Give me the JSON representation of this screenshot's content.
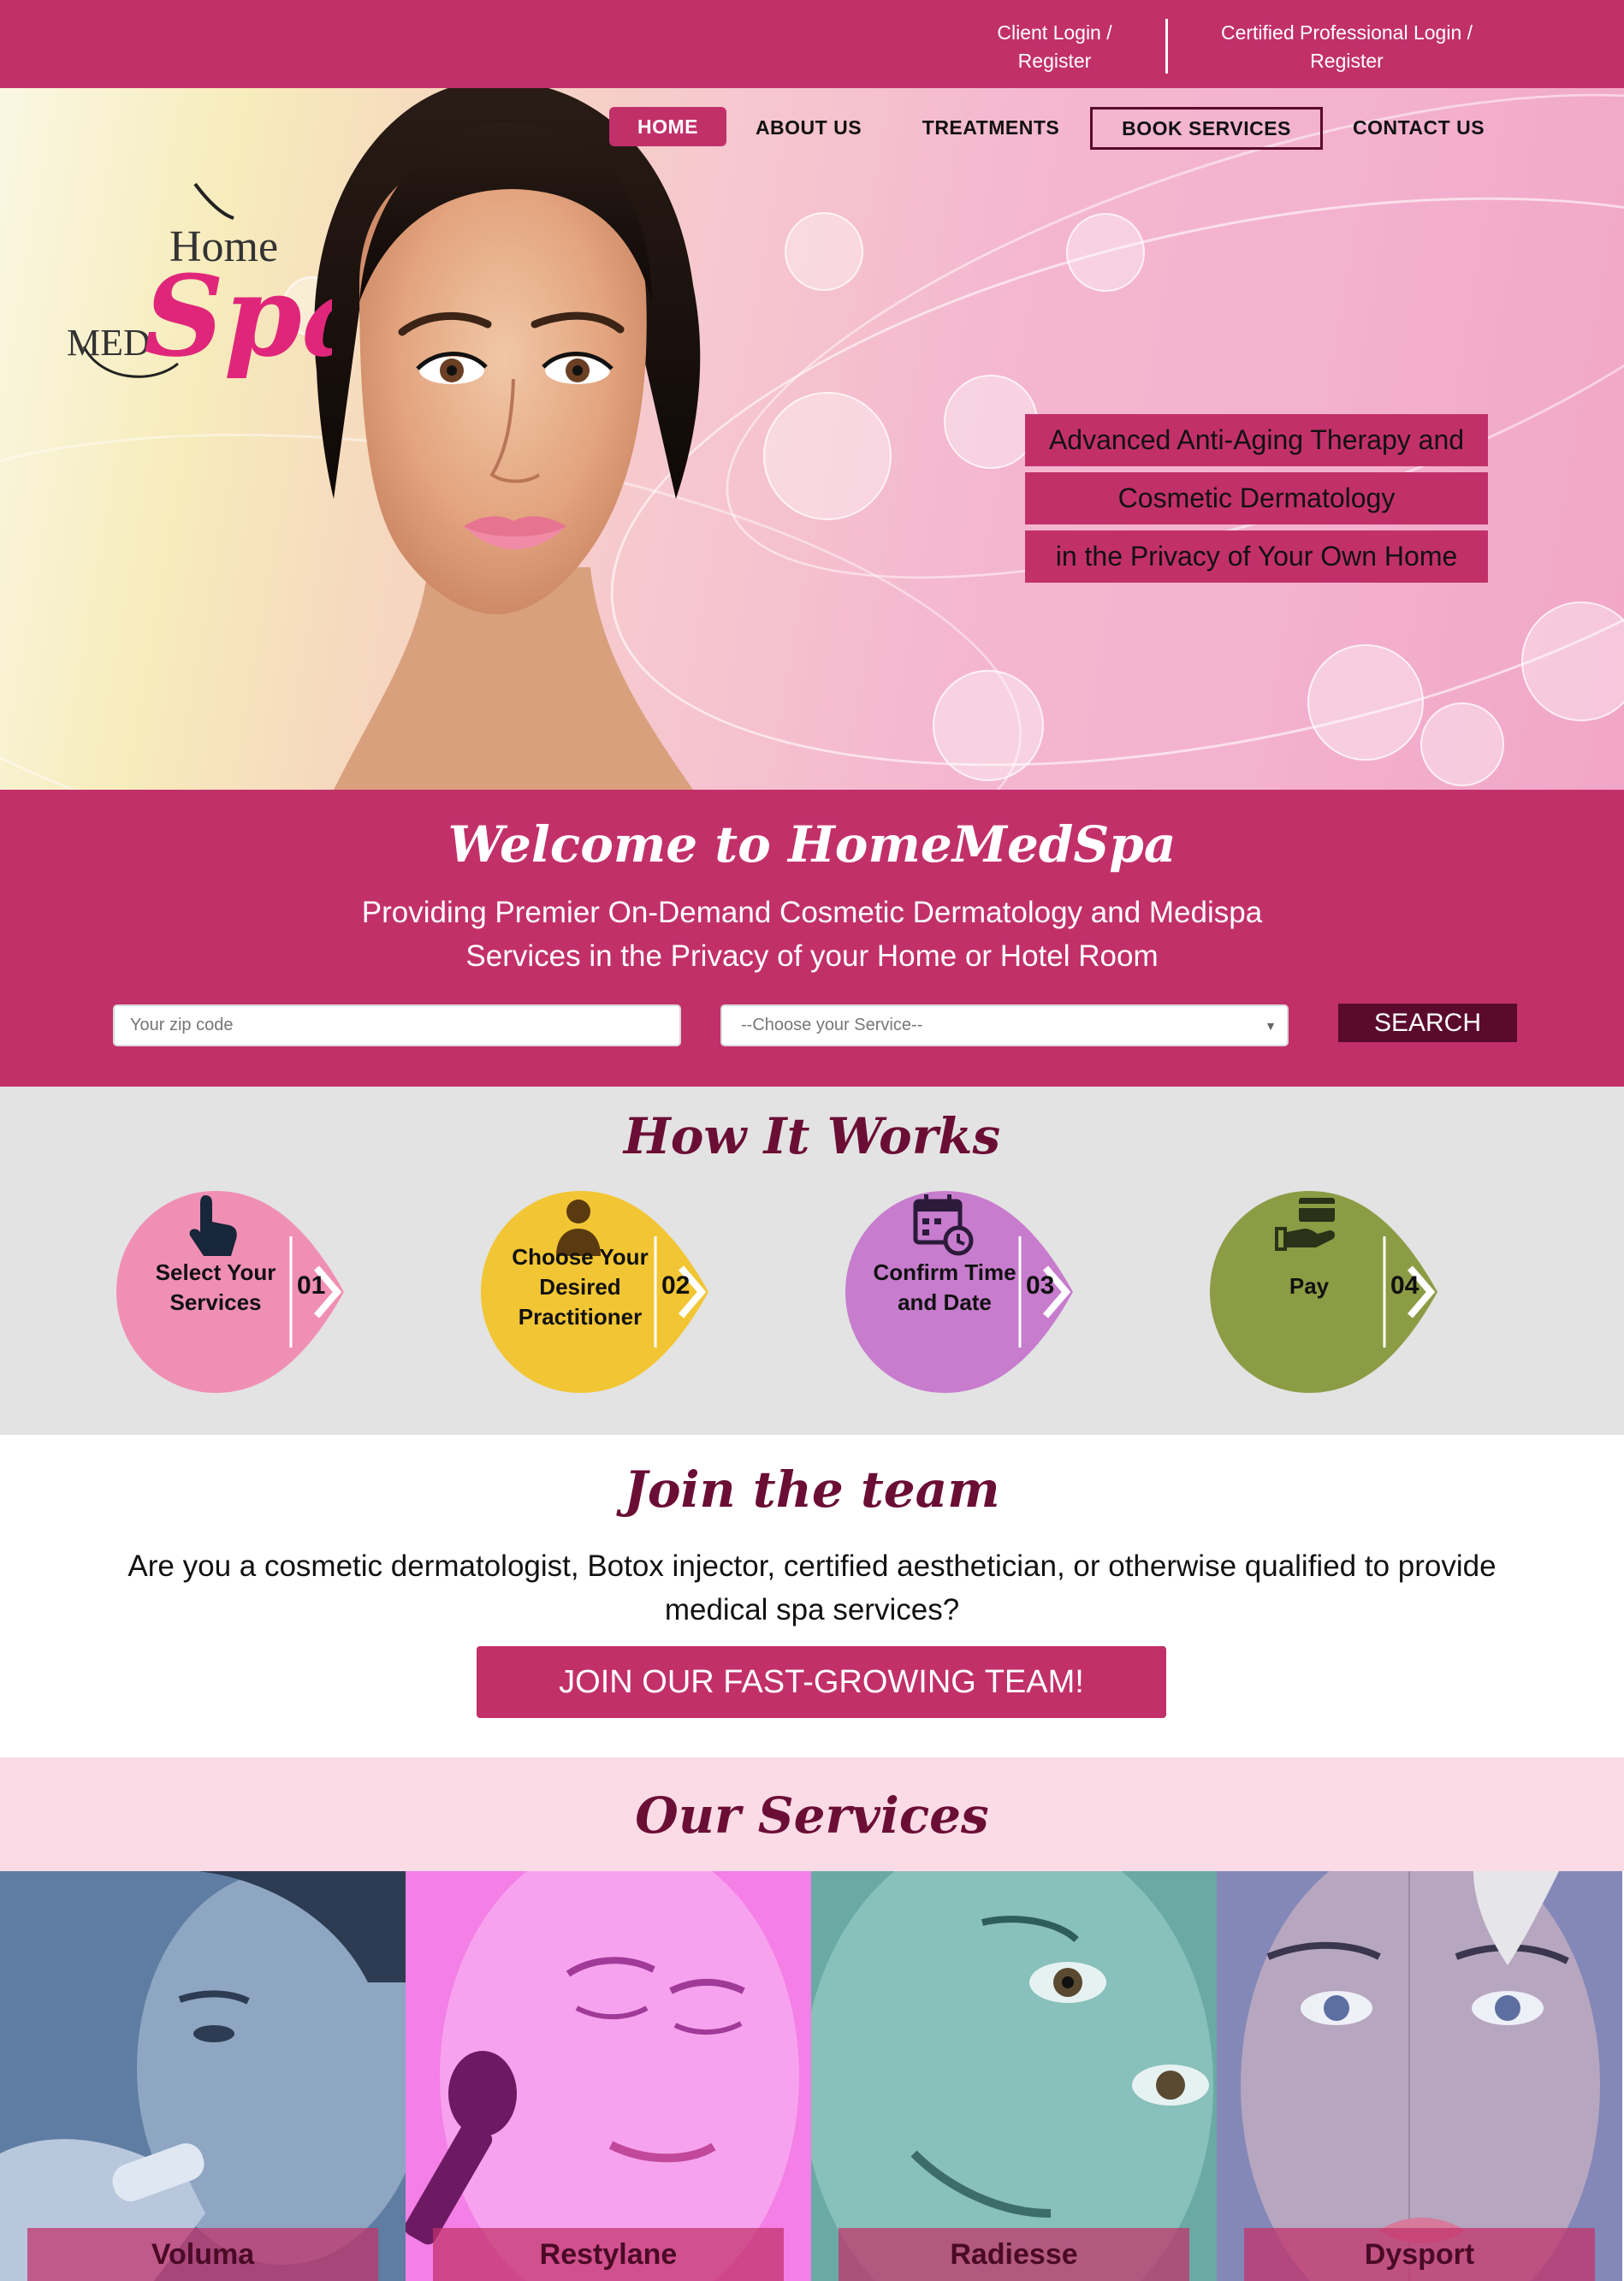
{
  "topbar": {
    "client_login": "Client Login / Register",
    "pro_login": "Certified Professional Login / Register"
  },
  "logo": {
    "text_home": "Home",
    "text_med": "MED",
    "text_spa": "Spa"
  },
  "nav": {
    "home": "HOME",
    "about": "ABOUT US",
    "treatments": "TREATMENTS",
    "book": "BOOK SERVICES",
    "contact": "CONTACT US"
  },
  "hero": {
    "taglines": [
      "Advanced Anti-Aging Therapy and",
      "Cosmetic Dermatology",
      "in the Privacy of Your Own Home"
    ]
  },
  "welcome": {
    "title": "Welcome to HomeMedSpa",
    "subtitle_line1": "Providing Premier On-Demand Cosmetic Dermatology and Medispa",
    "subtitle_line2": "Services in the Privacy of your Home or Hotel Room",
    "zip_placeholder": "Your zip code",
    "service_select": "--Choose your Service--",
    "search_label": "SEARCH"
  },
  "how": {
    "title": "How It Works",
    "steps": [
      {
        "label": "Select Your Services",
        "num": "01",
        "color": "#f08fb4",
        "icon": "pointer-hand-icon"
      },
      {
        "label": "Choose Your Desired Practitioner",
        "num": "02",
        "color": "#f2c534",
        "icon": "person-icon"
      },
      {
        "label": "Confirm Time and Date",
        "num": "03",
        "color": "#c77ccd",
        "icon": "calendar-clock-icon"
      },
      {
        "label": "Pay",
        "num": "04",
        "color": "#8c9c45",
        "icon": "hand-card-icon"
      }
    ]
  },
  "join": {
    "title": "Join the team",
    "text": "Are you a cosmetic dermatologist, Botox injector, certified aesthetician, or otherwise qualified to provide medical spa services?",
    "button": "JOIN OUR FAST-GROWING TEAM!"
  },
  "services": {
    "title": "Our Services",
    "items": [
      {
        "name": "Voluma",
        "tint": "#5f7da2"
      },
      {
        "name": "Restylane",
        "tint": "#f47fe6"
      },
      {
        "name": "Radiesse",
        "tint": "#6aa9a4"
      },
      {
        "name": "Dysport",
        "tint": "#8488b8"
      }
    ]
  },
  "colors": {
    "brand": "#c2306a",
    "dark": "#5a0a2c",
    "heading": "#6b0e36"
  }
}
